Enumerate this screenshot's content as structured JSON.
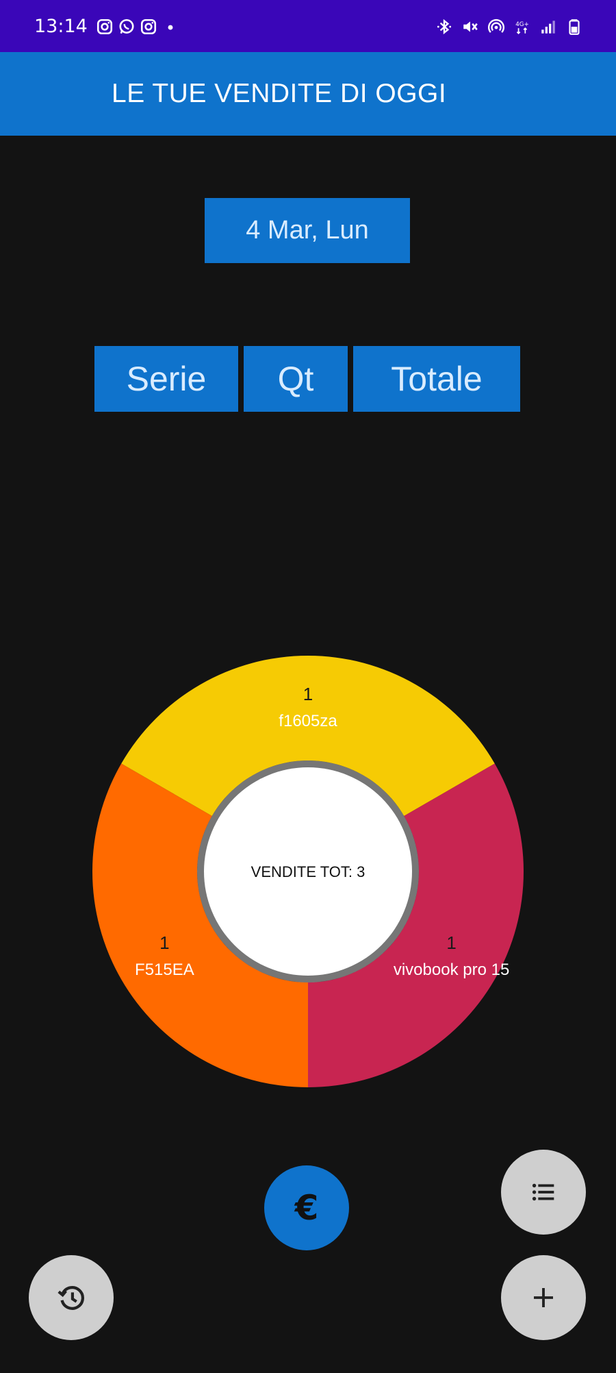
{
  "status_bar": {
    "time": "13:14",
    "icons_left": [
      "instagram-icon",
      "whatsapp-icon",
      "instagram-icon",
      "dot-icon"
    ],
    "icons_right": [
      "bluetooth-icon",
      "mute-icon",
      "hotspot-icon",
      "data-4g-icon",
      "signal-icon",
      "battery-icon"
    ]
  },
  "app_bar": {
    "title": "LE TUE VENDITE DI OGGI",
    "color": "#0f73cc"
  },
  "date_button": {
    "label": "4 Mar, Lun"
  },
  "segment_buttons": {
    "serie": "Serie",
    "qt": "Qt",
    "totale": "Totale"
  },
  "chart_data": {
    "type": "pie",
    "center_label": "VENDITE TOT: 3",
    "slices": [
      {
        "label": "f1605za",
        "value": 1,
        "color": "#f6cb04"
      },
      {
        "label": "vivobook pro 15",
        "value": 1,
        "color": "#c82551"
      },
      {
        "label": "F515EA",
        "value": 1,
        "color": "#ff6a00"
      }
    ]
  },
  "fabs": {
    "euro": {
      "icon": "euro-icon",
      "glyph": "€",
      "color": "#0f73cc"
    },
    "list": {
      "icon": "list-icon"
    },
    "history": {
      "icon": "history-icon"
    },
    "add": {
      "icon": "add-icon"
    }
  }
}
